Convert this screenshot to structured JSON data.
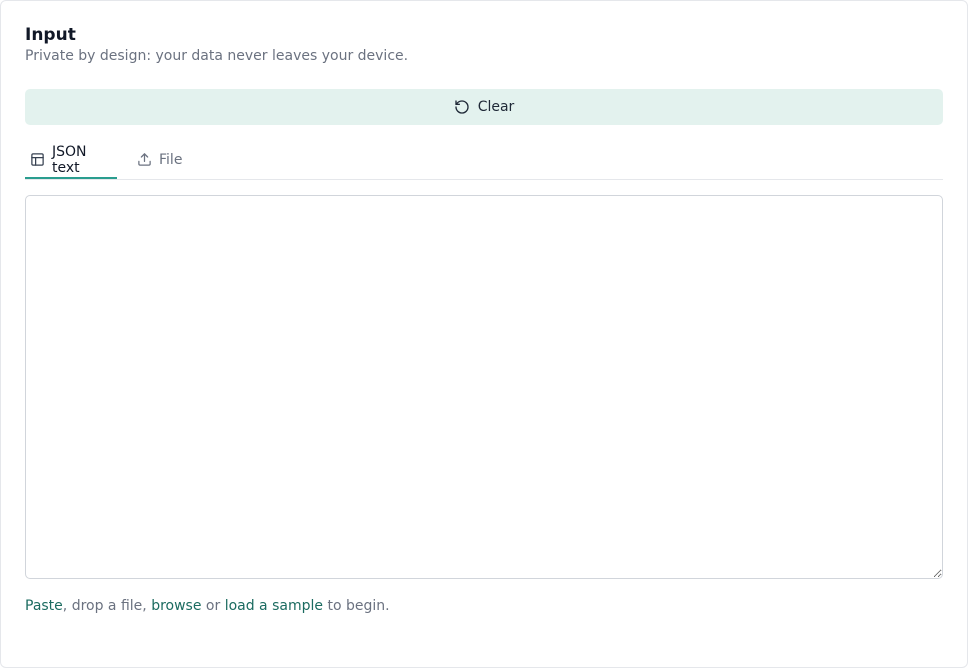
{
  "header": {
    "title": "Input",
    "subtitle": "Private by design: your data never leaves your device."
  },
  "toolbar": {
    "clear_label": "Clear",
    "clear_icon": "rotate-ccw-icon"
  },
  "tabs": [
    {
      "label": "JSON text",
      "icon": "table-icon",
      "active": true
    },
    {
      "label": "File",
      "icon": "upload-icon",
      "active": false
    }
  ],
  "editor": {
    "value": "",
    "placeholder": ""
  },
  "hint": {
    "paste": "Paste",
    "text1": ", drop a file, ",
    "browse": "browse",
    "text2": " or ",
    "sample": "load a sample",
    "text3": " to begin."
  },
  "colors": {
    "accent": "#2a9d8f",
    "link": "#1b6b60",
    "button_bg": "#e3f2ee",
    "muted_text": "#6b7280"
  }
}
